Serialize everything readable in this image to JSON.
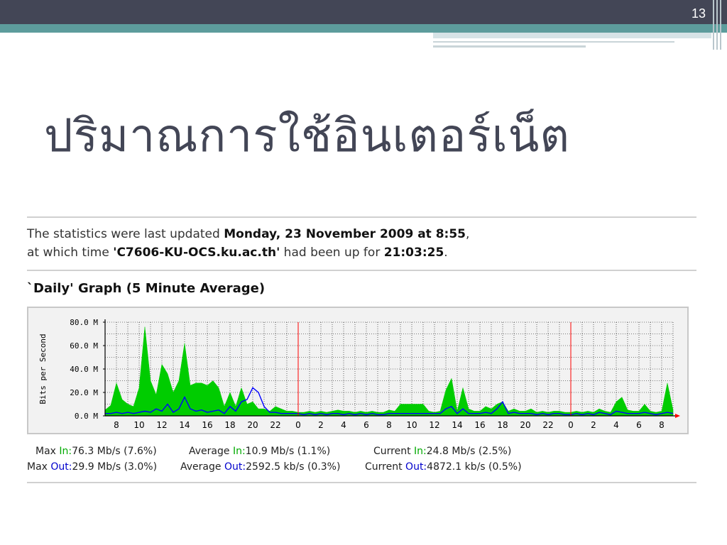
{
  "slide": {
    "number": "13",
    "title": "ปริมาณการใช้อินเตอร์เน็ต"
  },
  "stats": {
    "line1_prefix": "The statistics were last updated ",
    "line1_date": "Monday, 23 November 2009 at 8:55",
    "line1_suffix": ",",
    "line2_prefix": "at which time ",
    "line2_host": "'C7606-KU-OCS.ku.ac.th'",
    "line2_mid": " had been up for ",
    "line2_uptime": "21:03:25",
    "line2_suffix": "."
  },
  "graph_title": "`Daily' Graph (5 Minute Average)",
  "legend": {
    "in_row": {
      "max_label": "Max",
      "max_key": "In:",
      "max_val": "76.3 Mb/s (7.6%)",
      "avg_label": "Average",
      "avg_key": "In:",
      "avg_val": "10.9 Mb/s (1.1%)",
      "cur_label": "Current",
      "cur_key": "In:",
      "cur_val": "24.8 Mb/s (2.5%)"
    },
    "out_row": {
      "max_label": "Max",
      "max_key": "Out:",
      "max_val": "29.9 Mb/s (3.0%)",
      "avg_label": "Average",
      "avg_key": "Out:",
      "avg_val": "2592.5 kb/s (0.3%)",
      "cur_label": "Current",
      "cur_key": "Out:",
      "cur_val": "4872.1 kb/s (0.5%)"
    }
  },
  "colors": {
    "header_dark": "#434656",
    "header_teal": "#5d9c9c",
    "in": "#00cc00",
    "out": "#0000ff",
    "midnight": "#ff0000",
    "grid": "#000000"
  },
  "chart_data": {
    "type": "area",
    "ylabel": "Bits per Second",
    "y_ticks": [
      "0.0 M",
      "20.0 M",
      "40.0 M",
      "60.0 M",
      "80.0 M"
    ],
    "ylim": [
      0,
      80
    ],
    "x_ticks": [
      "8",
      "10",
      "12",
      "14",
      "16",
      "18",
      "20",
      "22",
      "0",
      "2",
      "4",
      "6",
      "8",
      "10",
      "12",
      "14",
      "16",
      "18",
      "20",
      "22",
      "0",
      "2",
      "4",
      "6",
      "8"
    ],
    "x_hours_start": 7,
    "midnight_markers_at_hour": [
      24,
      48
    ],
    "grid": true,
    "series": [
      {
        "name": "In",
        "kind": "area",
        "hours": [
          7,
          7.5,
          8,
          8.5,
          9,
          9.5,
          10,
          10.5,
          11,
          11.5,
          12,
          12.5,
          13,
          13.5,
          14,
          14.5,
          15,
          15.5,
          16,
          16.5,
          17,
          17.5,
          18,
          18.5,
          19,
          19.5,
          20,
          20.5,
          21,
          21.5,
          22,
          22.5,
          23,
          23.5,
          24,
          24.5,
          25,
          25.5,
          26,
          26.5,
          27,
          27.5,
          28,
          28.5,
          29,
          29.5,
          30,
          30.5,
          31,
          31.5,
          32,
          32.5,
          33,
          33.5,
          34,
          34.5,
          35,
          35.5,
          36,
          36.5,
          37,
          37.5,
          38,
          38.5,
          39,
          39.5,
          40,
          40.5,
          41,
          41.5,
          42,
          42.5,
          43,
          43.5,
          44,
          44.5,
          45,
          45.5,
          46,
          46.5,
          47,
          47.5,
          48,
          48.5,
          49,
          49.5,
          50,
          50.5,
          51,
          51.5,
          52,
          52.5,
          53,
          53.5,
          54,
          54.5,
          55,
          55.5,
          56,
          56.5,
          57
        ],
        "values": [
          5,
          9,
          28,
          14,
          10,
          8,
          24,
          76,
          30,
          18,
          44,
          36,
          20,
          30,
          62,
          26,
          28,
          28,
          26,
          30,
          24,
          8,
          20,
          8,
          24,
          10,
          12,
          6,
          6,
          4,
          8,
          6,
          4,
          4,
          3,
          3,
          4,
          3,
          4,
          3,
          4,
          5,
          4,
          4,
          3,
          4,
          3,
          4,
          3,
          3,
          5,
          4,
          10,
          10,
          10,
          10,
          10,
          4,
          3,
          4,
          22,
          32,
          4,
          24,
          6,
          4,
          4,
          8,
          6,
          10,
          12,
          4,
          6,
          4,
          4,
          6,
          3,
          4,
          3,
          4,
          4,
          3,
          3,
          4,
          3,
          4,
          3,
          6,
          4,
          3,
          12,
          16,
          5,
          4,
          4,
          10,
          4,
          3,
          4,
          28,
          5
        ],
        "value_unit": "Mb/s"
      },
      {
        "name": "Out",
        "kind": "line",
        "hours": [
          7,
          7.5,
          8,
          8.5,
          9,
          9.5,
          10,
          10.5,
          11,
          11.5,
          12,
          12.5,
          13,
          13.5,
          14,
          14.5,
          15,
          15.5,
          16,
          16.5,
          17,
          17.5,
          18,
          18.5,
          19,
          19.5,
          20,
          20.5,
          21,
          21.5,
          22,
          22.5,
          23,
          23.5,
          24,
          24.5,
          25,
          25.5,
          26,
          26.5,
          27,
          27.5,
          28,
          28.5,
          29,
          29.5,
          30,
          30.5,
          31,
          31.5,
          32,
          32.5,
          33,
          33.5,
          34,
          34.5,
          35,
          35.5,
          36,
          36.5,
          37,
          37.5,
          38,
          38.5,
          39,
          39.5,
          40,
          40.5,
          41,
          41.5,
          42,
          42.5,
          43,
          43.5,
          44,
          44.5,
          45,
          45.5,
          46,
          46.5,
          47,
          47.5,
          48,
          48.5,
          49,
          49.5,
          50,
          50.5,
          51,
          51.5,
          52,
          52.5,
          53,
          53.5,
          54,
          54.5,
          55,
          55.5,
          56,
          56.5,
          57
        ],
        "values": [
          2,
          2,
          3,
          2,
          3,
          2,
          3,
          4,
          3,
          6,
          4,
          10,
          3,
          6,
          16,
          6,
          4,
          5,
          3,
          4,
          5,
          2,
          8,
          4,
          12,
          14,
          24,
          20,
          8,
          3,
          3,
          2,
          2,
          2,
          2,
          1,
          2,
          1,
          2,
          1,
          2,
          2,
          1,
          2,
          1,
          2,
          1,
          2,
          1,
          1,
          2,
          2,
          2,
          2,
          2,
          2,
          2,
          2,
          2,
          2,
          6,
          8,
          2,
          6,
          2,
          2,
          2,
          3,
          2,
          6,
          12,
          2,
          3,
          2,
          2,
          2,
          1,
          2,
          1,
          2,
          2,
          1,
          1,
          2,
          1,
          2,
          1,
          3,
          2,
          1,
          4,
          3,
          2,
          2,
          2,
          3,
          2,
          1,
          2,
          3,
          2
        ],
        "value_unit": "Mb/s"
      }
    ]
  }
}
